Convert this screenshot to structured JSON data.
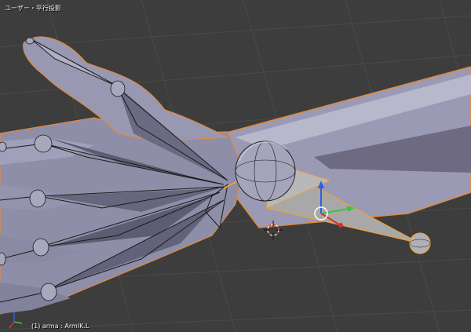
{
  "viewport": {
    "view_label": "ユーザー・平行投影",
    "object_label": "(1) arma : ArmIK.L"
  },
  "colors": {
    "background": "#3d3d3d",
    "grid": "#4a4a4a",
    "mesh": "#8e8ea8",
    "mesh_light": "#b4b4c8",
    "mesh_dark": "#5c5c72",
    "selection_outline": "#e08a3c",
    "bone_outline": "#1a1a1a",
    "selected_bone": "#a8a8a8",
    "selected_bone_outline": "#f0a030",
    "gizmo_x": "#d83030",
    "gizmo_y": "#40c040",
    "gizmo_z": "#3060e0"
  },
  "icons": [
    "3d-cursor-icon",
    "transform-gizmo-icon",
    "axis-gizmo-icon"
  ]
}
